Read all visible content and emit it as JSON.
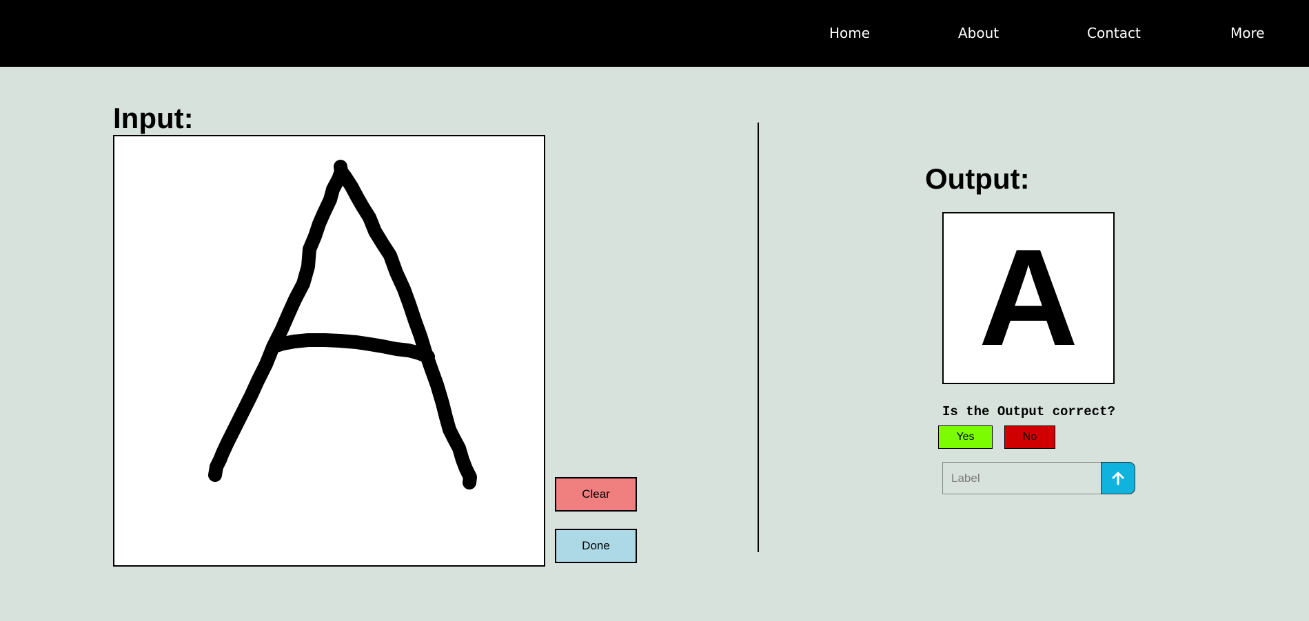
{
  "nav": {
    "links": [
      "Home",
      "About",
      "Contact",
      "More"
    ]
  },
  "input": {
    "title": "Input:",
    "clear_label": "Clear",
    "done_label": "Done"
  },
  "output": {
    "title": "Output:",
    "prediction": "A",
    "question": "Is the Output correct?",
    "yes_label": "Yes",
    "no_label": "No",
    "label_placeholder": "Label",
    "submit_icon": "arrow-up-icon"
  },
  "colors": {
    "page_background": "#d7e2dd",
    "nav_background": "#000000",
    "clear_button": "#f08080",
    "done_button": "#add8e6",
    "yes_button": "#7cfc00",
    "no_button": "#d00000",
    "submit_button": "#0fb3de"
  }
}
